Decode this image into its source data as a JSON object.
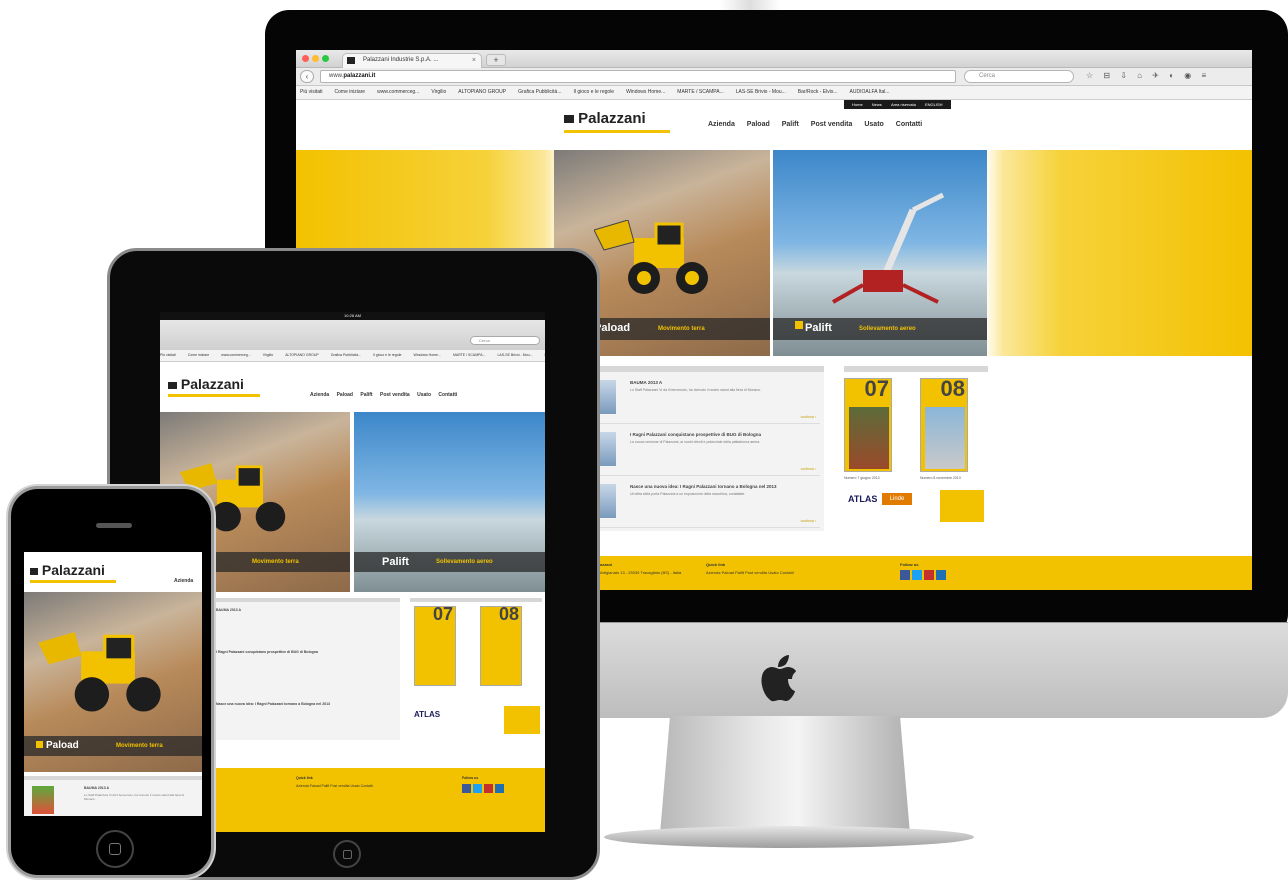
{
  "browser": {
    "tab_title": "Palazzani Industrie S.p.A. ...",
    "tab_close": "×",
    "new_tab": "+",
    "url_prefix": "www.",
    "url_domain": "palazzani.it",
    "search_placeholder": "Cerca",
    "bookmarks": [
      "Più visitati",
      "Come iniziare",
      "www.commerceg...",
      "Virgilio",
      "ALTOPIANO GROUP",
      "Grafica Pubblicità...",
      "Il gioco e le regole",
      "Windows Home...",
      "MARTE / SCAMPA...",
      "LAS-SE Brivio - Mou...",
      "Bar/Rock - Elvis...",
      "AUDIOALFA Ital..."
    ]
  },
  "site": {
    "brand": "Palazzani",
    "topnav": [
      "Home",
      "News",
      "Area riservata",
      "ENGLISH"
    ],
    "mainnav": [
      "Azienda",
      "Paload",
      "Palift",
      "Post vendita",
      "Usato",
      "Contatti"
    ],
    "hero": [
      {
        "brand": "Paload",
        "label": "Movimento terra"
      },
      {
        "brand": "Palift",
        "label": "Sollevamento aereo"
      }
    ],
    "news": [
      {
        "title": "BAUMA 2013 A",
        "text": "Lo Staff Palazzani Vi dà il benvenuto, ha ricevuto il nostro stand alla fiera di Monaco.",
        "more": "continua ›"
      },
      {
        "title": "I Ragni Palazzani conquistano prospettive di BUG di Bologna",
        "text": "La nuova versione di Palazzani, ai nostri clienti e potenziale della piattaforma aerea.",
        "more": "continua ›"
      },
      {
        "title": "Nasce una nuova idea: I Ragni Palazzani tornano a Bologna nel 2013",
        "text": "Un'altra sfida porta Palazzani a un esposizione della macchina, contattate.",
        "more": "continua ›"
      }
    ],
    "magazines": [
      {
        "number": "07",
        "caption": "Numero 7 giugno 2013"
      },
      {
        "number": "08",
        "caption": "Numero 8 novembre 2013"
      }
    ],
    "partners": [
      "ATLAS",
      "Linde"
    ],
    "footer": {
      "company_heading": "Palazzani",
      "company_address": "via Artigianato 13 - 25039 Travagliato (BS) - Italia",
      "links_heading": "Quick link",
      "links_text": "Azienda Paload Palift Post vendita Usato Contatti",
      "follow_heading": "Follow us"
    }
  },
  "ipad": {
    "status_time": "10:28 AM"
  },
  "colors": {
    "brand_yellow": "#f2c200",
    "frame_black": "#050505",
    "aluminum": "#c8c8c8"
  }
}
